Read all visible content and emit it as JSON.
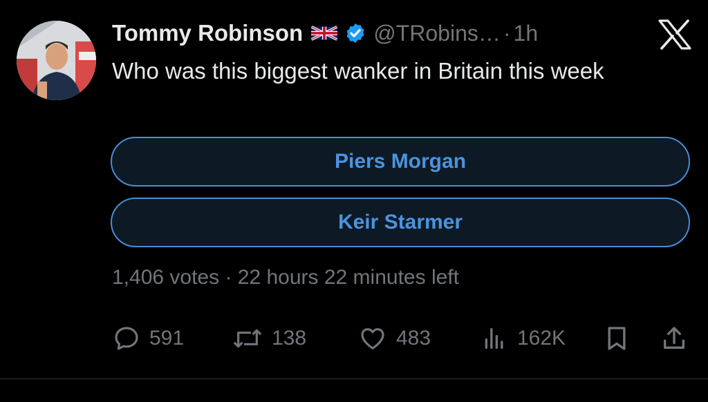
{
  "tweet": {
    "author_name": "Tommy Robinson",
    "flag_icon": "uk-flag-icon",
    "verified_icon": "verified-badge-icon",
    "verified_color": "#1d9bf0",
    "handle": "@TRobins…",
    "separator": "·",
    "time": "1h",
    "text": "Who was this biggest wanker in Britain this week"
  },
  "platform": {
    "logo": "x-logo-icon"
  },
  "poll": {
    "options": [
      "Piers Morgan",
      "Keir Starmer"
    ],
    "meta": "1,406 votes · 22 hours 22 minutes left",
    "border_color": "#4a8dd6",
    "text_color": "#4b93df"
  },
  "actions": {
    "replies": "591",
    "reposts": "138",
    "likes": "483",
    "views": "162K"
  }
}
